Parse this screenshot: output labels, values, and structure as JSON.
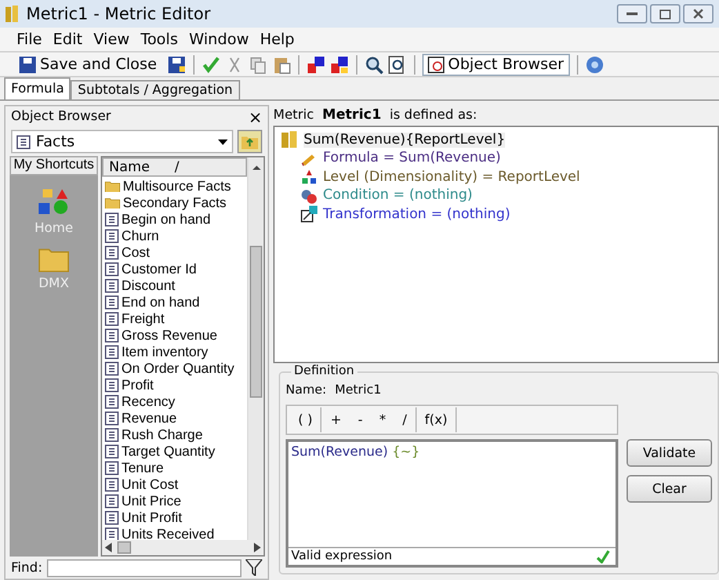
{
  "window": {
    "title": "Metric1 - Metric Editor"
  },
  "menu": [
    "File",
    "Edit",
    "View",
    "Tools",
    "Window",
    "Help"
  ],
  "toolbar": {
    "save_label": "Save and Close",
    "object_browser": {
      "label": "Object Browser",
      "selected": true
    }
  },
  "tabs": [
    {
      "label": "Formula",
      "selected": true
    },
    {
      "label": "Subtotals / Aggregation",
      "selected": false
    }
  ],
  "object_browser": {
    "title": "Object Browser",
    "close": "×",
    "folder": "Facts",
    "shortcuts_title": "My Shortcuts",
    "shortcuts": [
      {
        "label": "Home",
        "kind": "home"
      },
      {
        "label": "DMX",
        "kind": "folder"
      }
    ],
    "column": "Name",
    "sort_mark": "/",
    "items": [
      {
        "label": "Multisource Facts",
        "kind": "folder"
      },
      {
        "label": "Secondary Facts",
        "kind": "folder"
      },
      {
        "label": "Begin on hand",
        "kind": "fact"
      },
      {
        "label": "Churn",
        "kind": "fact"
      },
      {
        "label": "Cost",
        "kind": "fact"
      },
      {
        "label": "Customer Id",
        "kind": "fact"
      },
      {
        "label": "Discount",
        "kind": "fact"
      },
      {
        "label": "End on hand",
        "kind": "fact"
      },
      {
        "label": "Freight",
        "kind": "fact"
      },
      {
        "label": "Gross Revenue",
        "kind": "fact"
      },
      {
        "label": "Item inventory",
        "kind": "fact"
      },
      {
        "label": "On Order Quantity",
        "kind": "fact"
      },
      {
        "label": "Profit",
        "kind": "fact"
      },
      {
        "label": "Recency",
        "kind": "fact"
      },
      {
        "label": "Revenue",
        "kind": "fact"
      },
      {
        "label": "Rush Charge",
        "kind": "fact"
      },
      {
        "label": "Target Quantity",
        "kind": "fact"
      },
      {
        "label": "Tenure",
        "kind": "fact"
      },
      {
        "label": "Unit Cost",
        "kind": "fact"
      },
      {
        "label": "Unit Price",
        "kind": "fact"
      },
      {
        "label": "Unit Profit",
        "kind": "fact"
      },
      {
        "label": "Units Received",
        "kind": "fact"
      }
    ],
    "find_label": "Find:"
  },
  "definition_header": {
    "prefix": "Metric",
    "name": "Metric1",
    "suffix": "is defined as:"
  },
  "tree": {
    "root": "Sum(Revenue){ReportLevel}",
    "children": [
      {
        "label": "Formula = Sum(Revenue)",
        "kind": "formula",
        "color": "#4b2e83"
      },
      {
        "label": "Level (Dimensionality) = ReportLevel",
        "kind": "level",
        "color": "#6b5a2b"
      },
      {
        "label": "Condition = (nothing)",
        "kind": "condition",
        "color": "#2e8b8b"
      },
      {
        "label": "Transformation = (nothing)",
        "kind": "transformation",
        "color": "#3333cc"
      }
    ]
  },
  "definition": {
    "group_title": "Definition",
    "name_label": "Name:",
    "name_value": "Metric1",
    "operators": [
      [
        "( )"
      ],
      [
        "+",
        "-",
        "*",
        "/"
      ],
      [
        "f(x)"
      ]
    ],
    "expression": [
      {
        "text": "Sum(Revenue)",
        "kind": "formula"
      },
      {
        "text": " {~}",
        "kind": "level"
      }
    ],
    "status": "Valid expression",
    "valid": true,
    "buttons": [
      "Validate",
      "Clear"
    ]
  }
}
